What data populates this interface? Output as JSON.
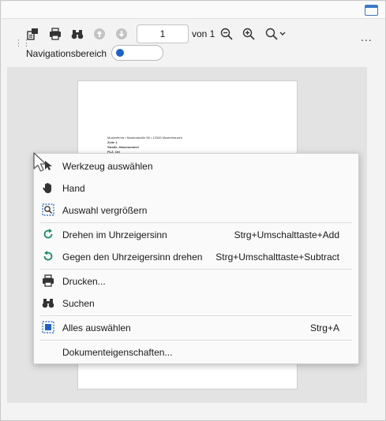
{
  "toolbar": {
    "page_number": "1",
    "page_of": "von 1",
    "more": "...",
    "nav_label": "Navigationsbereich"
  },
  "icons": {
    "sidebar": "sidebar-icon",
    "pages": "page-view-icon",
    "print": "print-icon",
    "find": "binoculars-icon",
    "prev": "arrow-up-icon",
    "next": "arrow-down-icon",
    "zoom_out": "zoom-out-icon",
    "zoom_in": "zoom-in-icon",
    "zoom": "zoom-icon"
  },
  "document": {
    "lines": [
      "Musterfirma • Musterstraße 56 • 12345 Musterhausen",
      "Zeile 1",
      "Straße, Hausnummer",
      "PLZ, Ort"
    ]
  },
  "context_menu": {
    "items": [
      {
        "label": "Werkzeug auswählen",
        "shortcut": "",
        "icon": "select-tool-icon"
      },
      {
        "label": "Hand",
        "shortcut": "",
        "icon": "hand-icon"
      },
      {
        "label": "Auswahl vergrößern",
        "shortcut": "",
        "icon": "zoom-selection-icon"
      },
      {
        "label": "Drehen im Uhrzeigersinn",
        "shortcut": "Strg+Umschalttaste+Add",
        "icon": "rotate-clockwise-icon"
      },
      {
        "label": "Gegen den Uhrzeigersinn drehen",
        "shortcut": "Strg+Umschalttaste+Subtract",
        "icon": "rotate-counterclockwise-icon"
      },
      {
        "label": "Drucken...",
        "shortcut": "",
        "icon": "print-icon"
      },
      {
        "label": "Suchen",
        "shortcut": "",
        "icon": "binoculars-icon"
      },
      {
        "label": "Alles auswählen",
        "shortcut": "Strg+A",
        "icon": "select-all-icon"
      },
      {
        "label": "Dokumenteigenschaften...",
        "shortcut": "",
        "icon": ""
      }
    ]
  },
  "colors": {
    "accent": "#1f62c4",
    "rotate": "#1a8a6a"
  }
}
